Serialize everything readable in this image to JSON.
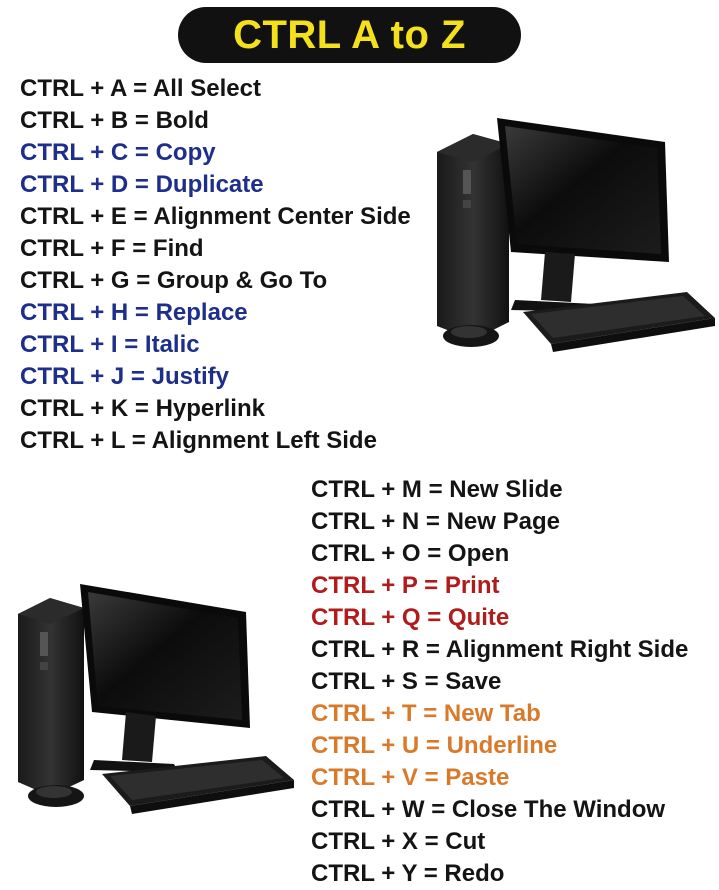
{
  "title": "CTRL A to Z",
  "colors": {
    "title_text": "#f5e11b",
    "title_bg": "#111111",
    "black": "#141414",
    "blue": "#1d2f8a",
    "red": "#b01c1c",
    "orange": "#d97a2a"
  },
  "shortcuts_top": [
    {
      "text": "CTRL + A = All Select",
      "color": "black"
    },
    {
      "text": "CTRL + B = Bold",
      "color": "black"
    },
    {
      "text": "CTRL + C = Copy",
      "color": "blue"
    },
    {
      "text": "CTRL + D = Duplicate",
      "color": "blue"
    },
    {
      "text": "CTRL + E = Alignment Center Side",
      "color": "black"
    },
    {
      "text": "CTRL + F = Find",
      "color": "black"
    },
    {
      "text": "CTRL + G = Group & Go To",
      "color": "black"
    },
    {
      "text": "CTRL + H = Replace",
      "color": "blue"
    },
    {
      "text": "CTRL + I  = Italic",
      "color": "blue"
    },
    {
      "text": "CTRL + J = Justify",
      "color": "blue"
    },
    {
      "text": "CTRL + K = Hyperlink",
      "color": "black"
    },
    {
      "text": "CTRL + L = Alignment Left Side",
      "color": "black"
    }
  ],
  "shortcuts_bottom": [
    {
      "text": "CTRL + M = New Slide",
      "color": "black"
    },
    {
      "text": "CTRL + N = New Page",
      "color": "black"
    },
    {
      "text": "CTRL + O = Open",
      "color": "black"
    },
    {
      "text": "CTRL + P = Print",
      "color": "red"
    },
    {
      "text": "CTRL + Q = Quite",
      "color": "red"
    },
    {
      "text": "CTRL + R = Alignment Right Side",
      "color": "black"
    },
    {
      "text": "CTRL + S = Save",
      "color": "black"
    },
    {
      "text": "CTRL + T = New Tab",
      "color": "orange"
    },
    {
      "text": "CTRL + U = Underline",
      "color": "orange"
    },
    {
      "text": "CTRL + V = Paste",
      "color": "orange"
    },
    {
      "text": "CTRL + W = Close The Window",
      "color": "black"
    },
    {
      "text": "CTRL + X = Cut",
      "color": "black"
    },
    {
      "text": "CTRL + Y = Redo",
      "color": "black"
    }
  ],
  "images": [
    {
      "name": "desktop-computer-illustration"
    },
    {
      "name": "desktop-computer-illustration"
    }
  ]
}
